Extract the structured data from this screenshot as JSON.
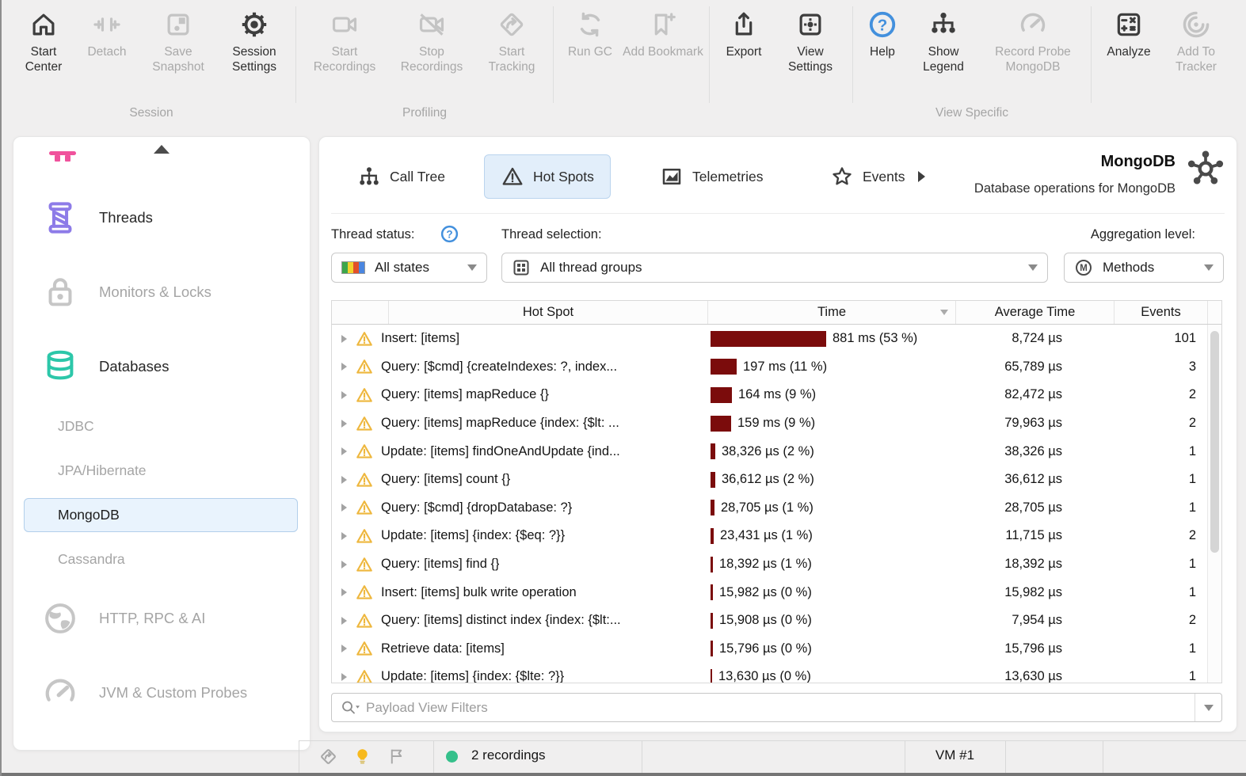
{
  "toolbar": {
    "groups": [
      {
        "label": "Session",
        "items": [
          {
            "label": "Start Center",
            "icon": "home-icon",
            "enabled": true
          },
          {
            "label": "Detach",
            "icon": "detach-icon",
            "enabled": false
          },
          {
            "label": "Save Snapshot",
            "icon": "save-snapshot-icon",
            "enabled": false
          },
          {
            "label": "Session Settings",
            "icon": "gear-icon",
            "enabled": true
          }
        ]
      },
      {
        "label": "Profiling",
        "items": [
          {
            "label": "Start Recordings",
            "icon": "camera-icon",
            "enabled": false
          },
          {
            "label": "Stop Recordings",
            "icon": "camera-off-icon",
            "enabled": false
          },
          {
            "label": "Start Tracking",
            "icon": "tracking-icon",
            "enabled": false
          }
        ]
      },
      {
        "label": "",
        "items": [
          {
            "label": "Run GC",
            "icon": "gc-icon",
            "enabled": false
          },
          {
            "label": "Add Bookmark",
            "icon": "bookmark-add-icon",
            "enabled": false
          }
        ]
      },
      {
        "label": "",
        "items": [
          {
            "label": "Export",
            "icon": "export-icon",
            "enabled": true
          },
          {
            "label": "View Settings",
            "icon": "view-settings-icon",
            "enabled": true
          }
        ]
      },
      {
        "label": "View Specific",
        "items": [
          {
            "label": "Help",
            "icon": "help-icon",
            "enabled": true
          },
          {
            "label": "Show Legend",
            "icon": "legend-icon",
            "enabled": true
          },
          {
            "label": "Record Probe MongoDB",
            "icon": "probe-icon",
            "enabled": false
          }
        ]
      },
      {
        "label": "",
        "items": [
          {
            "label": "Analyze",
            "icon": "analyze-icon",
            "enabled": true
          },
          {
            "label": "Add To Tracker",
            "icon": "tracker-icon",
            "enabled": false
          }
        ]
      }
    ]
  },
  "sidebar": {
    "items": [
      {
        "label": "Threads",
        "icon": "threads-icon",
        "kind": "top",
        "state": "normal"
      },
      {
        "label": "Monitors & Locks",
        "icon": "lock-icon",
        "kind": "top",
        "state": "disabled"
      },
      {
        "label": "Databases",
        "icon": "databases-icon",
        "kind": "top",
        "state": "normal"
      },
      {
        "label": "JDBC",
        "kind": "sub",
        "state": "disabled"
      },
      {
        "label": "JPA/Hibernate",
        "kind": "sub",
        "state": "disabled"
      },
      {
        "label": "MongoDB",
        "kind": "sub",
        "state": "selected"
      },
      {
        "label": "Cassandra",
        "kind": "sub",
        "state": "disabled"
      },
      {
        "label": "HTTP, RPC & AI",
        "icon": "globe-icon",
        "kind": "top",
        "state": "disabled"
      },
      {
        "label": "JVM & Custom Probes",
        "icon": "gauge-icon",
        "kind": "top",
        "state": "disabled"
      }
    ]
  },
  "view": {
    "tabs": [
      {
        "label": "Call Tree",
        "icon": "call-tree-icon",
        "selected": false
      },
      {
        "label": "Hot Spots",
        "icon": "hot-spots-icon",
        "selected": true
      },
      {
        "label": "Telemetries",
        "icon": "telemetries-icon",
        "selected": false
      },
      {
        "label": "Events",
        "icon": "events-icon",
        "selected": false,
        "has_more": true
      }
    ],
    "title": "MongoDB",
    "title_icon": "mongodb-probe-icon",
    "subtitle": "Database operations for MongoDB"
  },
  "filters": {
    "thread_status_label": "Thread status:",
    "thread_status_help_icon": "help-icon",
    "thread_status": {
      "value": "All states",
      "icon": "thread-states-icon"
    },
    "thread_selection_label": "Thread selection:",
    "thread_selection": {
      "value": "All thread groups",
      "icon": "thread-groups-icon"
    },
    "aggregation_label": "Aggregation level:",
    "aggregation": {
      "value": "Methods",
      "icon": "methods-icon"
    }
  },
  "table": {
    "columns": [
      {
        "label": "Hot Spot"
      },
      {
        "label": "Time",
        "sort": "desc"
      },
      {
        "label": "Average Time"
      },
      {
        "label": "Events"
      }
    ],
    "rows": [
      {
        "name": "Insert: [items]",
        "time_ms": 881,
        "time": "881 ms (53 %)",
        "avg": "8,724 µs",
        "events": "101"
      },
      {
        "name": "Query: [$cmd] {createIndexes: ?, index...",
        "time_ms": 197,
        "time": "197 ms (11 %)",
        "avg": "65,789 µs",
        "events": "3"
      },
      {
        "name": "Query: [items] mapReduce {}",
        "time_ms": 164,
        "time": "164 ms (9 %)",
        "avg": "82,472 µs",
        "events": "2"
      },
      {
        "name": "Query: [items] mapReduce {index: {$lt: ...",
        "time_ms": 159,
        "time": "159 ms (9 %)",
        "avg": "79,963 µs",
        "events": "2"
      },
      {
        "name": "Update: [items] findOneAndUpdate {ind...",
        "time_ms": 38.3,
        "time": "38,326 µs (2 %)",
        "avg": "38,326 µs",
        "events": "1"
      },
      {
        "name": "Query: [items] count {}",
        "time_ms": 36.6,
        "time": "36,612 µs (2 %)",
        "avg": "36,612 µs",
        "events": "1"
      },
      {
        "name": "Query: [$cmd] {dropDatabase: ?}",
        "time_ms": 28.7,
        "time": "28,705 µs (1 %)",
        "avg": "28,705 µs",
        "events": "1"
      },
      {
        "name": "Update: [items] {index: {$eq: ?}}",
        "time_ms": 23.4,
        "time": "23,431 µs (1 %)",
        "avg": "11,715 µs",
        "events": "2"
      },
      {
        "name": "Query: [items] find {}",
        "time_ms": 18.4,
        "time": "18,392 µs (1 %)",
        "avg": "18,392 µs",
        "events": "1"
      },
      {
        "name": "Insert: [items] bulk write operation",
        "time_ms": 16.0,
        "time": "15,982 µs (0 %)",
        "avg": "15,982 µs",
        "events": "1"
      },
      {
        "name": "Query: [items] distinct index {index: {$lt:...",
        "time_ms": 15.9,
        "time": "15,908 µs (0 %)",
        "avg": "7,954 µs",
        "events": "2"
      },
      {
        "name": "Retrieve data: [items]",
        "time_ms": 15.8,
        "time": "15,796 µs (0 %)",
        "avg": "15,796 µs",
        "events": "1"
      },
      {
        "name": "Update: [items] {index: {$lte: ?}}",
        "time_ms": 13.6,
        "time": "13,630 µs (0 %)",
        "avg": "13,630 µs",
        "events": "1"
      }
    ]
  },
  "payload_filter": {
    "placeholder": "Payload View Filters"
  },
  "status_bar": {
    "icons": [
      "tracking-icon",
      "bulb-icon",
      "flag-icon"
    ],
    "recording_indicator": "recording-dot",
    "recordings_label": "2 recordings",
    "vm_label": "VM #1"
  },
  "colors": {
    "time_bar": "#7b0c0c",
    "selected_bg": "#e2eefa",
    "selected_border": "#bad4ee",
    "warning_amber": "#eeb73e",
    "recording_green": "#35c08b",
    "bulb_yellow": "#f7b91d",
    "help_blue": "#4390dd",
    "threads_purple": "#8d7be8",
    "databases_teal": "#2cc7a9"
  }
}
